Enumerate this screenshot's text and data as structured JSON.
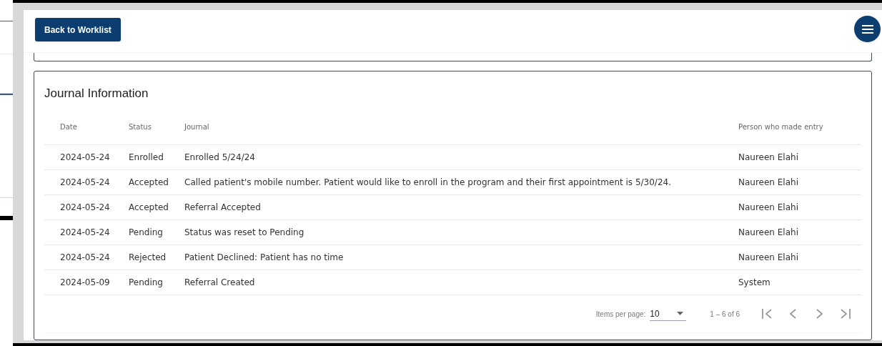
{
  "header": {
    "back_button": "Back to Worklist"
  },
  "journal": {
    "title": "Journal Information",
    "columns": [
      "Date",
      "Status",
      "Journal",
      "Person who made entry"
    ],
    "rows": [
      [
        "2024-05-24",
        "Enrolled",
        "Enrolled 5/24/24",
        "Naureen Elahi"
      ],
      [
        "2024-05-24",
        "Accepted",
        "Called patient's mobile number. Patient would like to enroll in the program and their first appointment is 5/30/24.",
        "Naureen Elahi"
      ],
      [
        "2024-05-24",
        "Accepted",
        "Referral Accepted",
        "Naureen Elahi"
      ],
      [
        "2024-05-24",
        "Pending",
        "Status was reset to Pending",
        "Naureen Elahi"
      ],
      [
        "2024-05-24",
        "Rejected",
        "Patient Declined: Patient has no time",
        "Naureen Elahi"
      ],
      [
        "2024-05-09",
        "Pending",
        "Referral Created",
        "System"
      ]
    ],
    "paginator": {
      "items_label": "Items per page:",
      "page_size": "10",
      "range": "1 – 6 of 6"
    }
  }
}
